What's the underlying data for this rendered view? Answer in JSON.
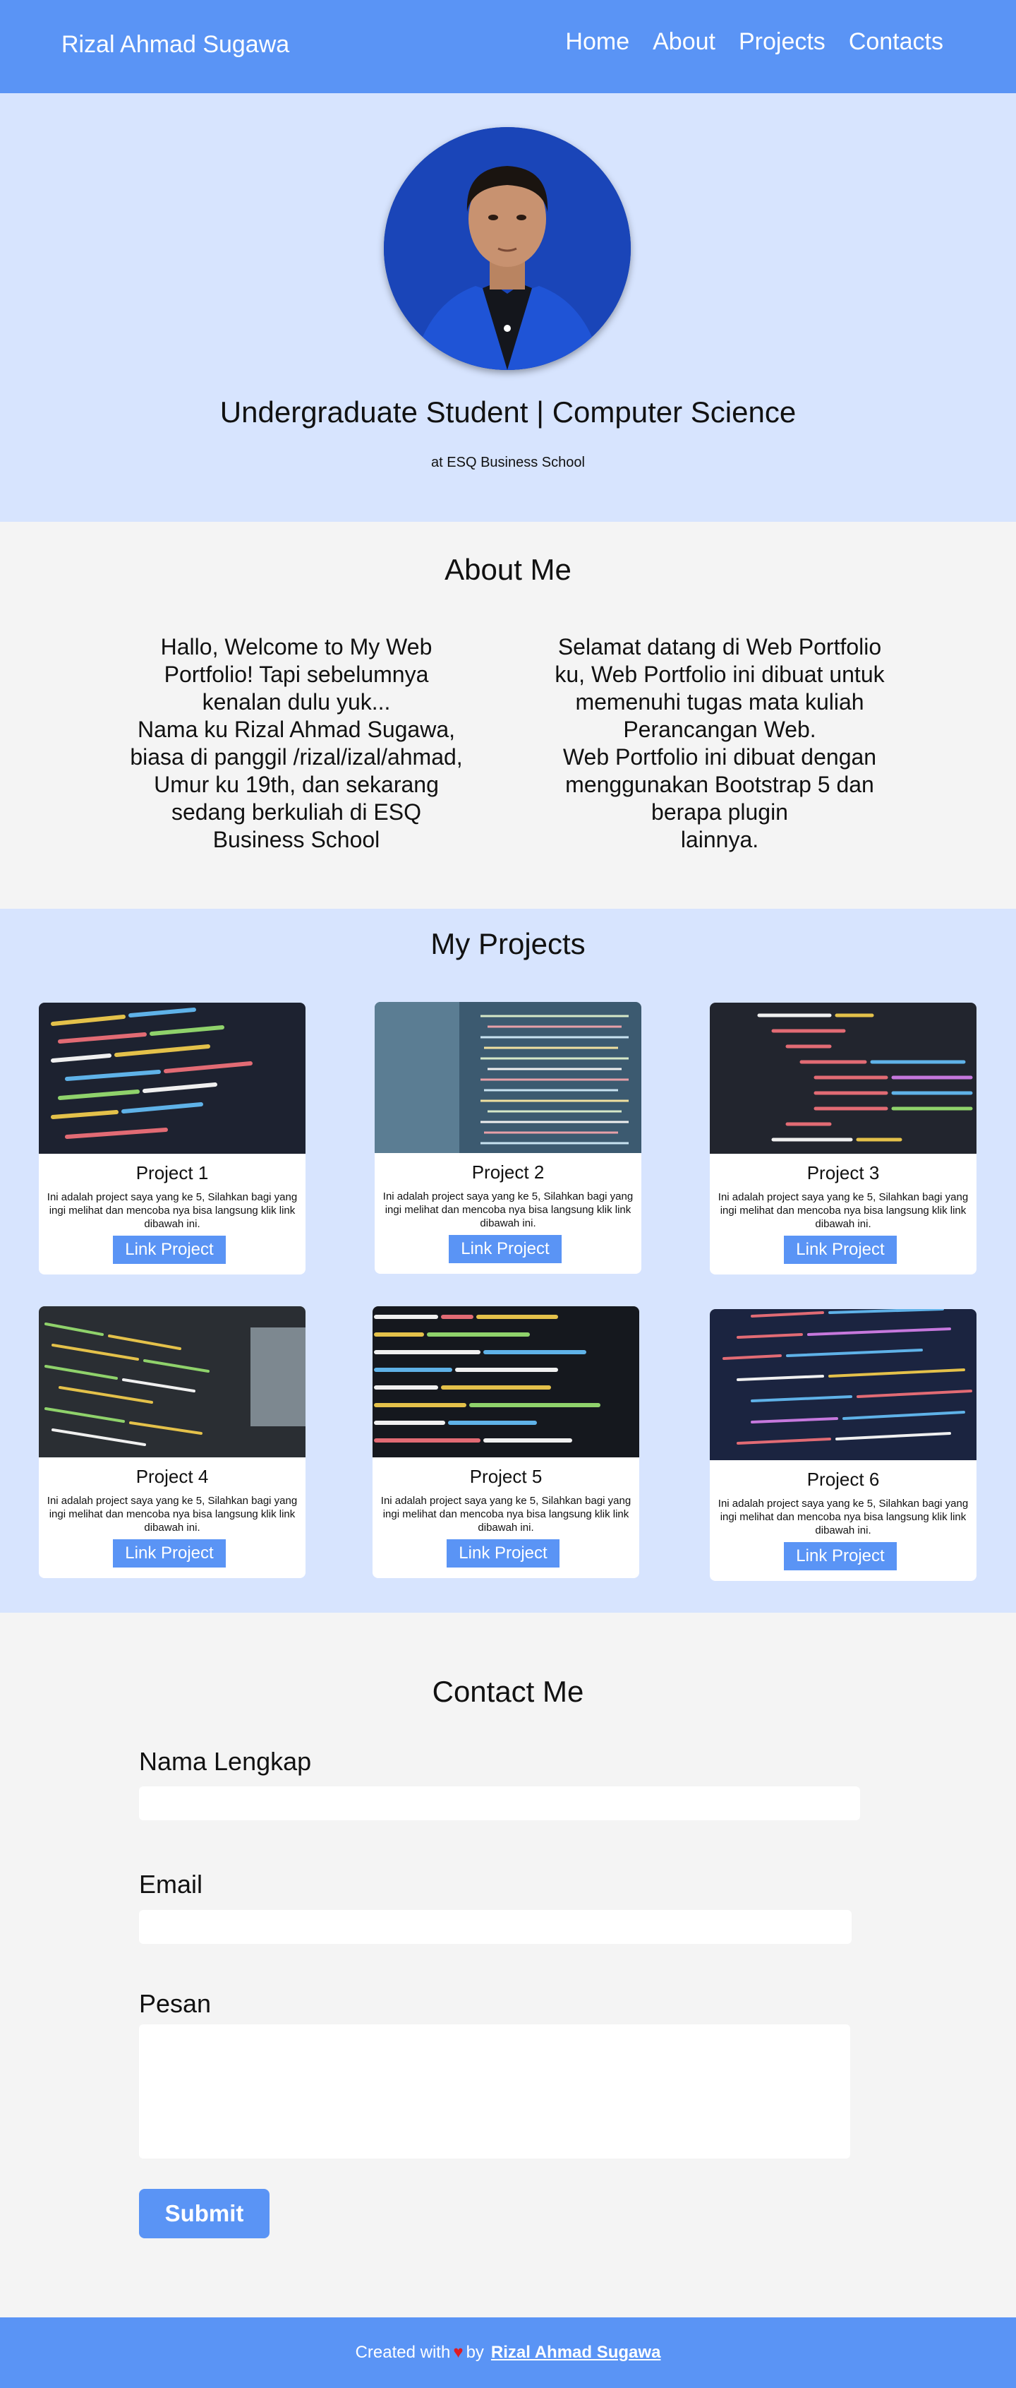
{
  "navbar": {
    "brand": "Rizal Ahmad Sugawa",
    "links": [
      "Home",
      "About",
      "Projects",
      "Contacts"
    ]
  },
  "hero": {
    "title": "Undergraduate Student | Computer Science",
    "subtitle": "at ESQ Business School"
  },
  "about": {
    "title": "About Me",
    "left_text": "Hallo, Welcome to My Web\nPortfolio! Tapi sebelumnya\nkenalan dulu yuk...\nNama ku Rizal Ahmad Sugawa,\nbiasa di panggil /rizal/izal/ahmad,\nUmur ku 19th, dan sekarang\nsedang berkuliah di ESQ\nBusiness School",
    "right_text": "Selamat datang di Web Portfolio\nku, Web Portfolio ini dibuat untuk\nmemenuhi tugas mata kuliah\nPerancangan Web.\nWeb Portfolio ini dibuat dengan\nmenggunakan Bootstrap 5 dan\nberapa plugin\nlainnya."
  },
  "projects": {
    "title": "My Projects",
    "cards": [
      {
        "title": "Project 1",
        "text": "Ini adalah project saya yang ke 5, Silahkan bagi yang ingi melihat dan mencoba nya bisa langsung klik link dibawah ini.",
        "button": "Link Project"
      },
      {
        "title": "Project 2",
        "text": "Ini adalah project saya yang ke 5, Silahkan bagi yang ingi melihat dan mencoba nya bisa langsung klik link dibawah ini.",
        "button": "Link Project"
      },
      {
        "title": "Project 3",
        "text": "Ini adalah project saya yang ke 5, Silahkan bagi yang ingi melihat dan mencoba nya bisa langsung klik link dibawah ini.",
        "button": "Link Project"
      },
      {
        "title": "Project 4",
        "text": "Ini adalah project saya yang ke 5, Silahkan bagi yang ingi melihat dan mencoba nya bisa langsung klik link dibawah ini.",
        "button": "Link Project"
      },
      {
        "title": "Project 5",
        "text": "Ini adalah project saya yang ke 5, Silahkan bagi yang ingi melihat dan mencoba nya bisa langsung klik link dibawah ini.",
        "button": "Link Project"
      },
      {
        "title": "Project 6",
        "text": "Ini adalah project saya yang ke 5, Silahkan bagi yang ingi melihat dan mencoba nya bisa langsung klik link dibawah ini.",
        "button": "Link Project"
      }
    ]
  },
  "contact": {
    "title": "Contact Me",
    "name_label": "Nama Lengkap",
    "name_value": "",
    "email_label": "Email",
    "email_value": "",
    "message_label": "Pesan",
    "message_value": "",
    "submit": "Submit"
  },
  "footer": {
    "prefix": "Created with",
    "heart": "♥",
    "by": "by",
    "author": "Rizal Ahmad Sugawa"
  },
  "colors": {
    "primary": "#5a94f5",
    "hero_bg": "#d7e4fe",
    "section_bg": "#f4f4f4",
    "heart": "#e01b22"
  }
}
